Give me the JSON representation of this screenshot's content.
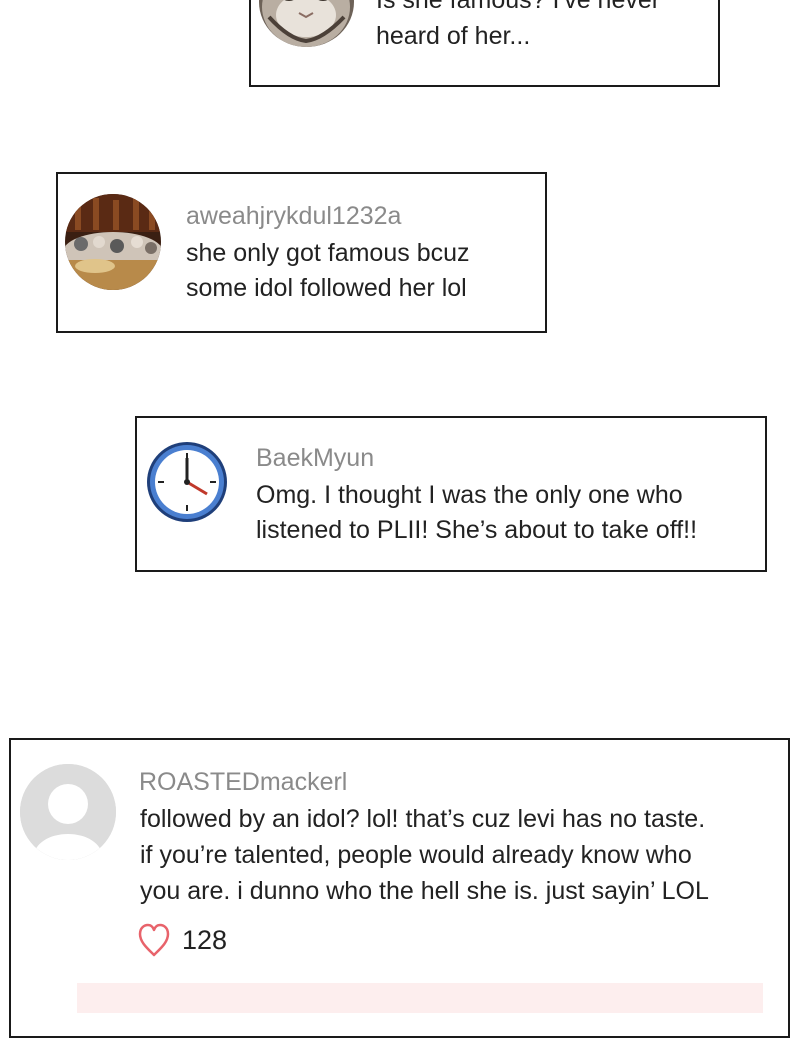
{
  "comments": [
    {
      "avatar": "cat-avatar",
      "text": "Is she famous? I've never\nheard of her..."
    },
    {
      "avatar": "crowd-photo-avatar",
      "username": "aweahjrykdul1232a",
      "text": "she only got famous bcuz\nsome idol followed her lol"
    },
    {
      "avatar": "clock-icon",
      "username": "BaekMyun",
      "text": "Omg. I thought I was the only one who\nlistened to PLII! She’s about to take off!!"
    },
    {
      "avatar": "default-user-icon",
      "username": "ROASTEDmackerl",
      "text": "followed by an idol? lol! that’s cuz levi has no taste.\nif you’re talented, people would already know who\nyou are. i dunno who the hell she is. just sayin’ LOL",
      "likes": "128",
      "like_icon": "heart-outline-icon",
      "accent_color": "#e8636b"
    }
  ]
}
